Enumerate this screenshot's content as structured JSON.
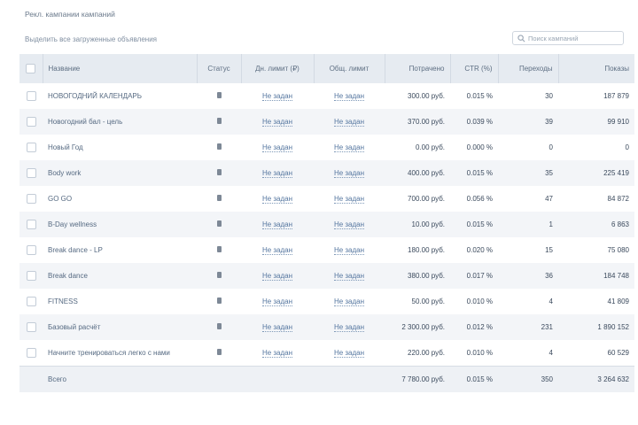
{
  "header": {
    "title": "Рекл. кампании кампаний",
    "select_all_label": "Выделить все загруженные объявления"
  },
  "search": {
    "placeholder": "Поиск кампаний"
  },
  "table": {
    "columns": [
      "Название",
      "Статус",
      "Дн. лимит (₽)",
      "Общ. лимит",
      "Потрачено",
      "CTR (%)",
      "Переходы",
      "Показы"
    ],
    "rows": [
      {
        "name": "НОВОГОДНИЙ КАЛЕНДАРЬ",
        "status": "II",
        "daily": "Не задан",
        "total": "Не задан",
        "spent": "300.00 руб.",
        "ctr": "0.015 %",
        "clicks": "30",
        "views": "187 879"
      },
      {
        "name": "Новогодний бал - цель",
        "status": "II",
        "daily": "Не задан",
        "total": "Не задан",
        "spent": "370.00 руб.",
        "ctr": "0.039 %",
        "clicks": "39",
        "views": "99 910"
      },
      {
        "name": "Новый Год",
        "status": "II",
        "daily": "Не задан",
        "total": "Не задан",
        "spent": "0.00 руб.",
        "ctr": "0.000 %",
        "clicks": "0",
        "views": "0"
      },
      {
        "name": "Body work",
        "status": "II",
        "daily": "Не задан",
        "total": "Не задан",
        "spent": "400.00 руб.",
        "ctr": "0.015 %",
        "clicks": "35",
        "views": "225 419"
      },
      {
        "name": "GO GO",
        "status": "II",
        "daily": "Не задан",
        "total": "Не задан",
        "spent": "700.00 руб.",
        "ctr": "0.056 %",
        "clicks": "47",
        "views": "84 872"
      },
      {
        "name": "B-Day wellness",
        "status": "II",
        "daily": "Не задан",
        "total": "Не задан",
        "spent": "10.00 руб.",
        "ctr": "0.015 %",
        "clicks": "1",
        "views": "6 863"
      },
      {
        "name": "Break dance - LP",
        "status": "II",
        "daily": "Не задан",
        "total": "Не задан",
        "spent": "180.00 руб.",
        "ctr": "0.020 %",
        "clicks": "15",
        "views": "75 080"
      },
      {
        "name": "Break dance",
        "status": "II",
        "daily": "Не задан",
        "total": "Не задан",
        "spent": "380.00 руб.",
        "ctr": "0.017 %",
        "clicks": "36",
        "views": "184 748"
      },
      {
        "name": "FITNESS",
        "status": "II",
        "daily": "Не задан",
        "total": "Не задан",
        "spent": "50.00 руб.",
        "ctr": "0.010 %",
        "clicks": "4",
        "views": "41 809"
      },
      {
        "name": "Базовый расчёт",
        "status": "II",
        "daily": "Не задан",
        "total": "Не задан",
        "spent": "2 300.00 руб.",
        "ctr": "0.012 %",
        "clicks": "231",
        "views": "1 890 152"
      },
      {
        "name": "Начните тренироваться легко с нами",
        "status": "II",
        "daily": "Не задан",
        "total": "Не задан",
        "spent": "220.00 руб.",
        "ctr": "0.010 %",
        "clicks": "4",
        "views": "60 529"
      }
    ],
    "footer": {
      "label": "Всего",
      "spent": "7 780.00 руб.",
      "ctr": "0.015 %",
      "clicks": "350",
      "views": "3 264 632"
    }
  }
}
